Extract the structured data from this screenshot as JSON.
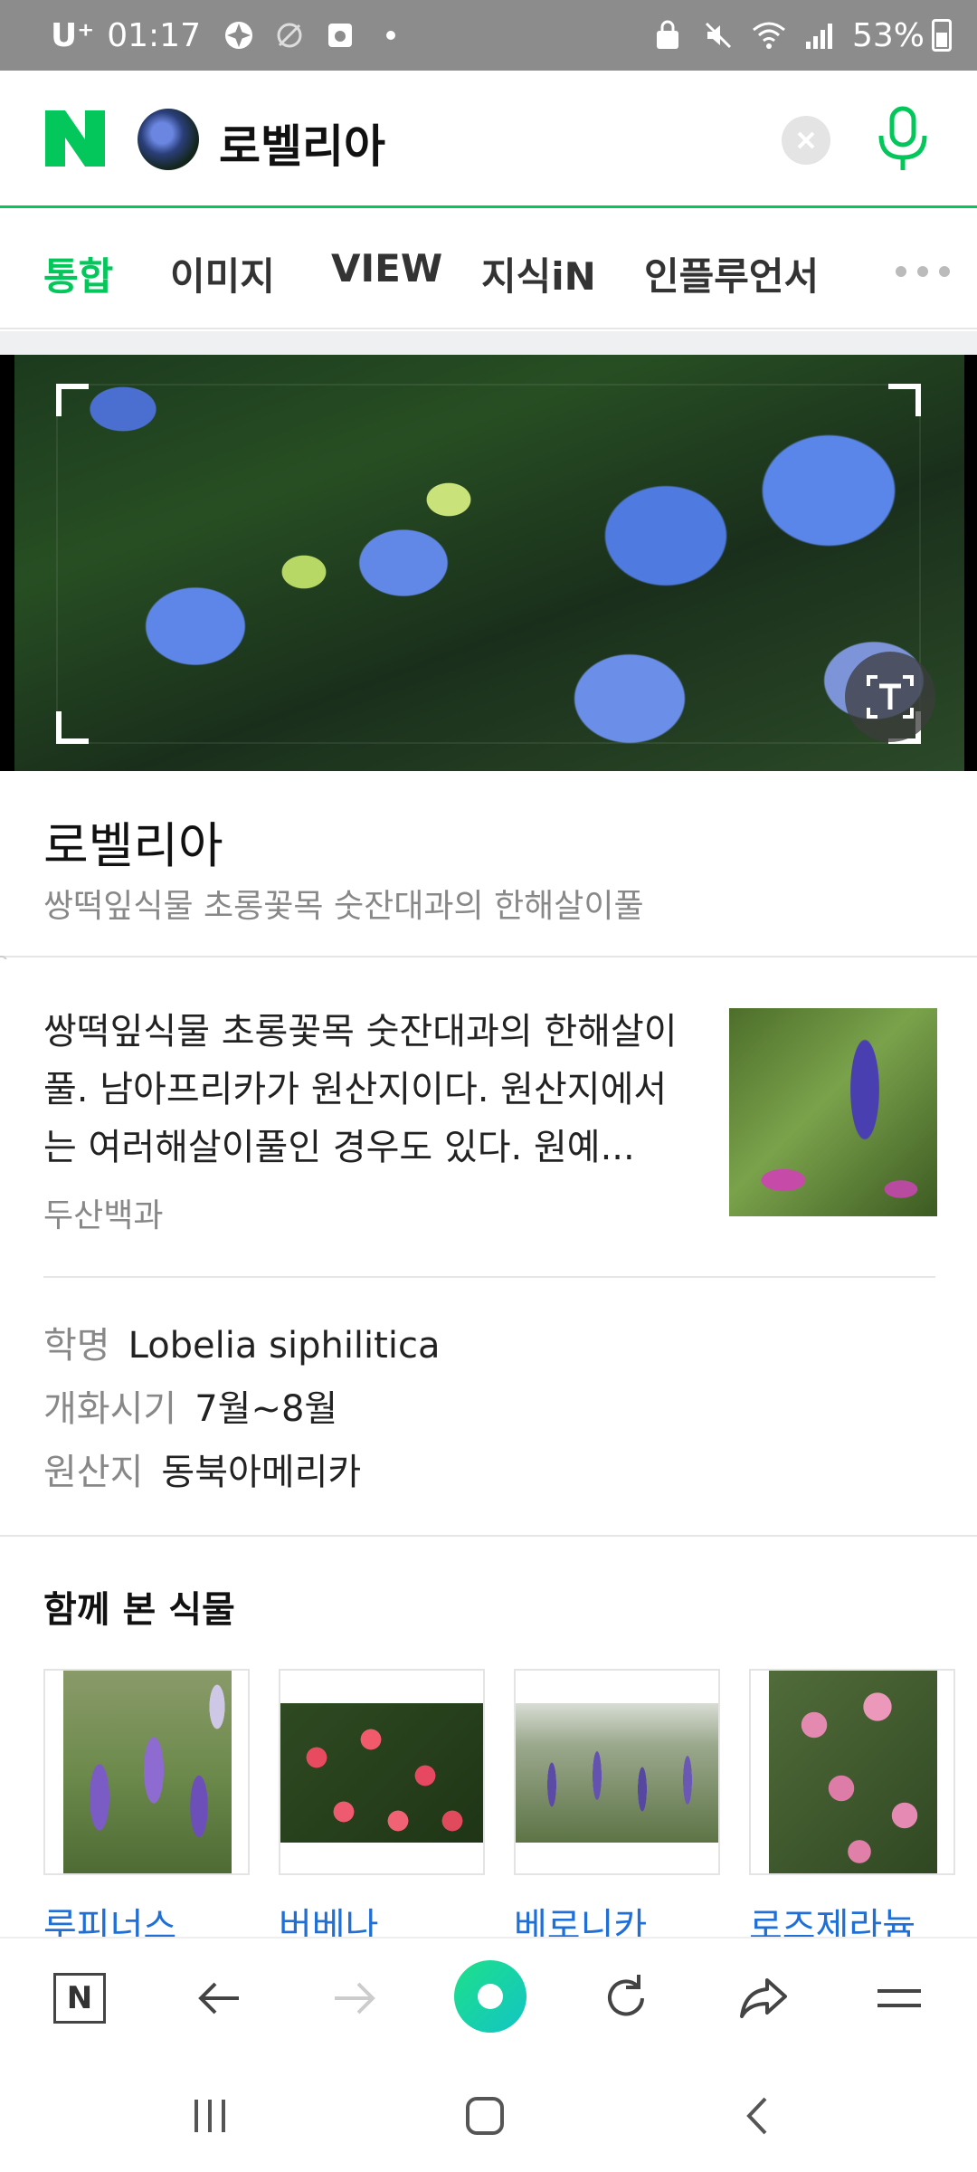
{
  "status_bar": {
    "carrier": "U⁺",
    "time": "01:17",
    "battery": "53%"
  },
  "search": {
    "query": "로벨리아",
    "brand_color": "#03c75a"
  },
  "tabs": [
    {
      "label": "통합",
      "active": true
    },
    {
      "label": "이미지",
      "active": false
    },
    {
      "label": "VIEW",
      "active": false
    },
    {
      "label": "지식iN",
      "active": false
    },
    {
      "label": "인플루언서",
      "active": false
    }
  ],
  "plant": {
    "name": "로벨리아",
    "subtitle": "쌍떡잎식물 초롱꽃목 숫잔대과의 한해살이풀",
    "description": "쌍떡잎식물 초롱꽃목 숫잔대과의 한해살이풀. 남아프리카가 원산지이다. 원산지에서는 여러해살이풀인 경우도 있다. 원예...",
    "source": "두산백과",
    "info": [
      {
        "label": "학명",
        "value": "Lobelia siphilitica"
      },
      {
        "label": "개화시기",
        "value": "7월~8월"
      },
      {
        "label": "원산지",
        "value": "동북아메리카"
      }
    ]
  },
  "related": {
    "title": "함께 본 식물",
    "items": [
      {
        "label": "루피너스"
      },
      {
        "label": "버베나"
      },
      {
        "label": "베로니카"
      },
      {
        "label": "로즈제라늄"
      }
    ]
  },
  "icons": {
    "home": "naver-home-icon",
    "back": "back-arrow-icon",
    "forward": "forward-arrow-icon",
    "green": "green-dot-icon",
    "refresh": "refresh-icon",
    "share": "share-icon",
    "menu": "menu-icon"
  }
}
